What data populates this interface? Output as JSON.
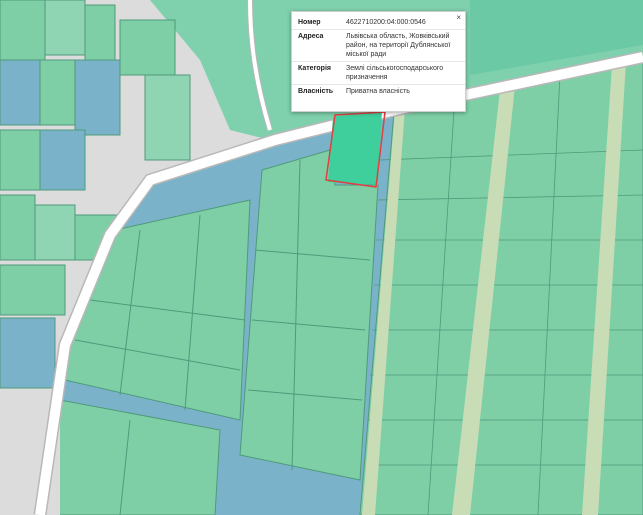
{
  "colors": {
    "background": "#dcdcdc",
    "parcel_fill": "#7ecfa6",
    "parcel_stroke": "#4f9a7b",
    "parcel_light": "#8fd4b3",
    "water_blue": "#7ab3c9",
    "road": "#ffffff",
    "track": "#c8dcb6",
    "selected_fill": "#3ecf9c",
    "selected_outline": "#e04040",
    "band_teal": "#6fcfae"
  },
  "popup": {
    "close_icon": "×",
    "rows": [
      {
        "key": "Номер",
        "value": "4622710200:04:000:0546"
      },
      {
        "key": "Адреса",
        "value": "Львівська область, Жовківський район, на території Дублянської міської ради"
      },
      {
        "key": "Категорія",
        "value": "Землі сільськогосподарського призначення"
      },
      {
        "key": "Власність",
        "value": "Приватна власність"
      }
    ]
  }
}
